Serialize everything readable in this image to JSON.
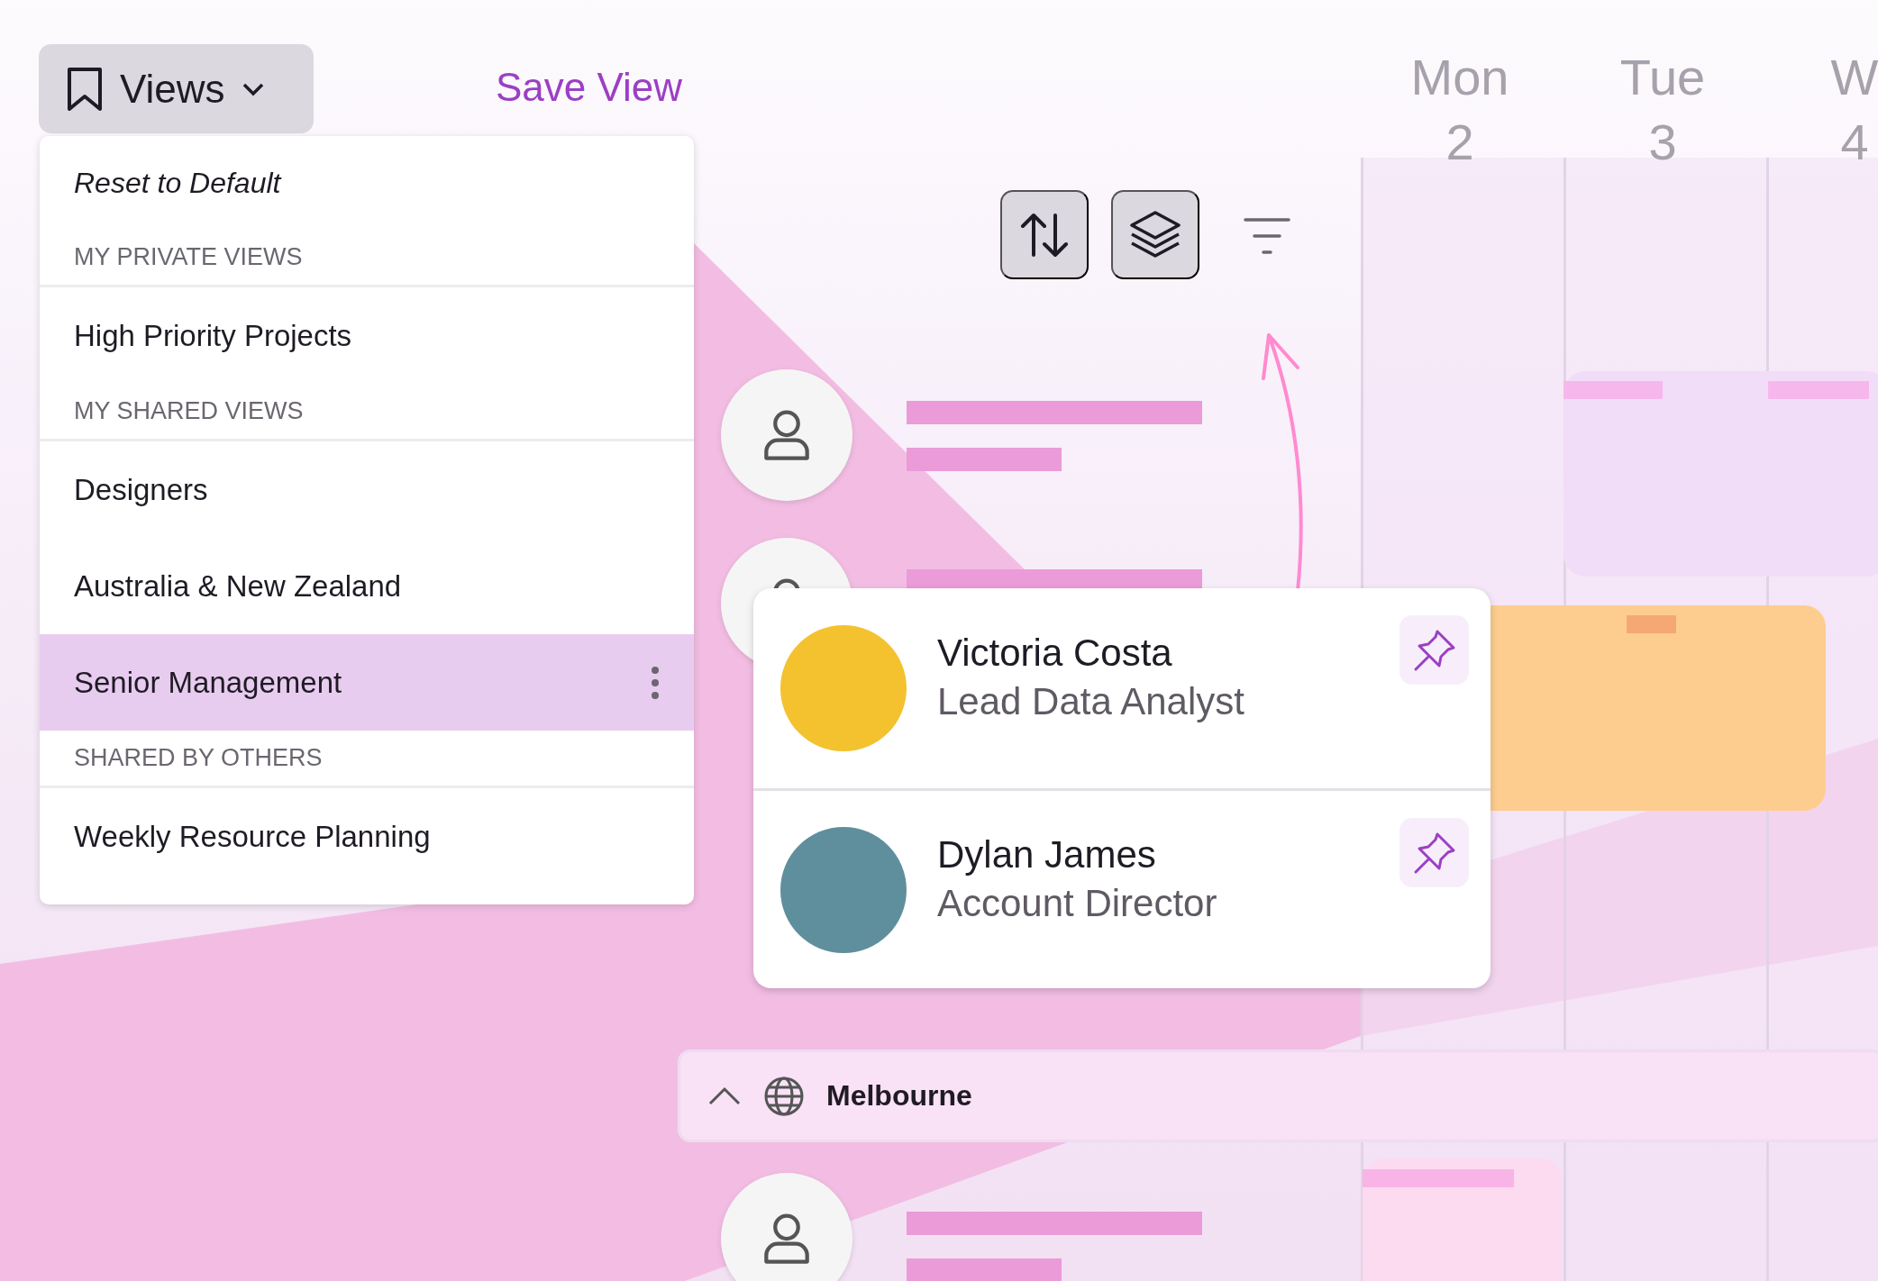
{
  "toolbar": {
    "views_button": {
      "label": "Views"
    },
    "save_view": "Save View"
  },
  "views_menu": {
    "reset": "Reset to Default",
    "sections": [
      {
        "heading": "MY PRIVATE VIEWS",
        "items": [
          {
            "label": "High Priority Projects",
            "selected": false
          }
        ]
      },
      {
        "heading": "MY SHARED VIEWS",
        "items": [
          {
            "label": "Designers",
            "selected": false
          },
          {
            "label": "Australia & New Zealand",
            "selected": false
          },
          {
            "label": "Senior Management",
            "selected": true
          }
        ]
      },
      {
        "heading": "SHARED BY OTHERS",
        "items": [
          {
            "label": "Weekly Resource Planning",
            "selected": false
          }
        ]
      }
    ]
  },
  "days": [
    {
      "name": "Mon",
      "date": "2"
    },
    {
      "name": "Tue",
      "date": "3"
    },
    {
      "name": "W",
      "date": "4"
    }
  ],
  "people_card": [
    {
      "name": "Victoria Costa",
      "role": "Lead Data Analyst",
      "color": "#f4c22f"
    },
    {
      "name": "Dylan James",
      "role": "Account Director",
      "color": "#5f8f9c"
    }
  ],
  "group": {
    "name": "Melbourne",
    "expanded": true
  }
}
